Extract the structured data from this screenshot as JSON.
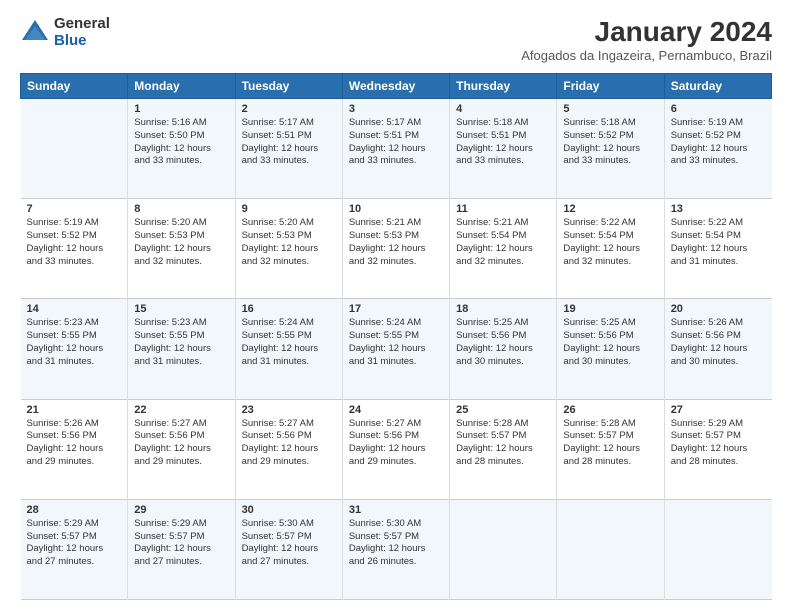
{
  "logo": {
    "general": "General",
    "blue": "Blue"
  },
  "title": "January 2024",
  "subtitle": "Afogados da Ingazeira, Pernambuco, Brazil",
  "headers": [
    "Sunday",
    "Monday",
    "Tuesday",
    "Wednesday",
    "Thursday",
    "Friday",
    "Saturday"
  ],
  "weeks": [
    [
      {
        "day": "",
        "info": ""
      },
      {
        "day": "1",
        "info": "Sunrise: 5:16 AM\nSunset: 5:50 PM\nDaylight: 12 hours\nand 33 minutes."
      },
      {
        "day": "2",
        "info": "Sunrise: 5:17 AM\nSunset: 5:51 PM\nDaylight: 12 hours\nand 33 minutes."
      },
      {
        "day": "3",
        "info": "Sunrise: 5:17 AM\nSunset: 5:51 PM\nDaylight: 12 hours\nand 33 minutes."
      },
      {
        "day": "4",
        "info": "Sunrise: 5:18 AM\nSunset: 5:51 PM\nDaylight: 12 hours\nand 33 minutes."
      },
      {
        "day": "5",
        "info": "Sunrise: 5:18 AM\nSunset: 5:52 PM\nDaylight: 12 hours\nand 33 minutes."
      },
      {
        "day": "6",
        "info": "Sunrise: 5:19 AM\nSunset: 5:52 PM\nDaylight: 12 hours\nand 33 minutes."
      }
    ],
    [
      {
        "day": "7",
        "info": "Sunrise: 5:19 AM\nSunset: 5:52 PM\nDaylight: 12 hours\nand 33 minutes."
      },
      {
        "day": "8",
        "info": "Sunrise: 5:20 AM\nSunset: 5:53 PM\nDaylight: 12 hours\nand 32 minutes."
      },
      {
        "day": "9",
        "info": "Sunrise: 5:20 AM\nSunset: 5:53 PM\nDaylight: 12 hours\nand 32 minutes."
      },
      {
        "day": "10",
        "info": "Sunrise: 5:21 AM\nSunset: 5:53 PM\nDaylight: 12 hours\nand 32 minutes."
      },
      {
        "day": "11",
        "info": "Sunrise: 5:21 AM\nSunset: 5:54 PM\nDaylight: 12 hours\nand 32 minutes."
      },
      {
        "day": "12",
        "info": "Sunrise: 5:22 AM\nSunset: 5:54 PM\nDaylight: 12 hours\nand 32 minutes."
      },
      {
        "day": "13",
        "info": "Sunrise: 5:22 AM\nSunset: 5:54 PM\nDaylight: 12 hours\nand 31 minutes."
      }
    ],
    [
      {
        "day": "14",
        "info": "Sunrise: 5:23 AM\nSunset: 5:55 PM\nDaylight: 12 hours\nand 31 minutes."
      },
      {
        "day": "15",
        "info": "Sunrise: 5:23 AM\nSunset: 5:55 PM\nDaylight: 12 hours\nand 31 minutes."
      },
      {
        "day": "16",
        "info": "Sunrise: 5:24 AM\nSunset: 5:55 PM\nDaylight: 12 hours\nand 31 minutes."
      },
      {
        "day": "17",
        "info": "Sunrise: 5:24 AM\nSunset: 5:55 PM\nDaylight: 12 hours\nand 31 minutes."
      },
      {
        "day": "18",
        "info": "Sunrise: 5:25 AM\nSunset: 5:56 PM\nDaylight: 12 hours\nand 30 minutes."
      },
      {
        "day": "19",
        "info": "Sunrise: 5:25 AM\nSunset: 5:56 PM\nDaylight: 12 hours\nand 30 minutes."
      },
      {
        "day": "20",
        "info": "Sunrise: 5:26 AM\nSunset: 5:56 PM\nDaylight: 12 hours\nand 30 minutes."
      }
    ],
    [
      {
        "day": "21",
        "info": "Sunrise: 5:26 AM\nSunset: 5:56 PM\nDaylight: 12 hours\nand 29 minutes."
      },
      {
        "day": "22",
        "info": "Sunrise: 5:27 AM\nSunset: 5:56 PM\nDaylight: 12 hours\nand 29 minutes."
      },
      {
        "day": "23",
        "info": "Sunrise: 5:27 AM\nSunset: 5:56 PM\nDaylight: 12 hours\nand 29 minutes."
      },
      {
        "day": "24",
        "info": "Sunrise: 5:27 AM\nSunset: 5:56 PM\nDaylight: 12 hours\nand 29 minutes."
      },
      {
        "day": "25",
        "info": "Sunrise: 5:28 AM\nSunset: 5:57 PM\nDaylight: 12 hours\nand 28 minutes."
      },
      {
        "day": "26",
        "info": "Sunrise: 5:28 AM\nSunset: 5:57 PM\nDaylight: 12 hours\nand 28 minutes."
      },
      {
        "day": "27",
        "info": "Sunrise: 5:29 AM\nSunset: 5:57 PM\nDaylight: 12 hours\nand 28 minutes."
      }
    ],
    [
      {
        "day": "28",
        "info": "Sunrise: 5:29 AM\nSunset: 5:57 PM\nDaylight: 12 hours\nand 27 minutes."
      },
      {
        "day": "29",
        "info": "Sunrise: 5:29 AM\nSunset: 5:57 PM\nDaylight: 12 hours\nand 27 minutes."
      },
      {
        "day": "30",
        "info": "Sunrise: 5:30 AM\nSunset: 5:57 PM\nDaylight: 12 hours\nand 27 minutes."
      },
      {
        "day": "31",
        "info": "Sunrise: 5:30 AM\nSunset: 5:57 PM\nDaylight: 12 hours\nand 26 minutes."
      },
      {
        "day": "",
        "info": ""
      },
      {
        "day": "",
        "info": ""
      },
      {
        "day": "",
        "info": ""
      }
    ]
  ]
}
